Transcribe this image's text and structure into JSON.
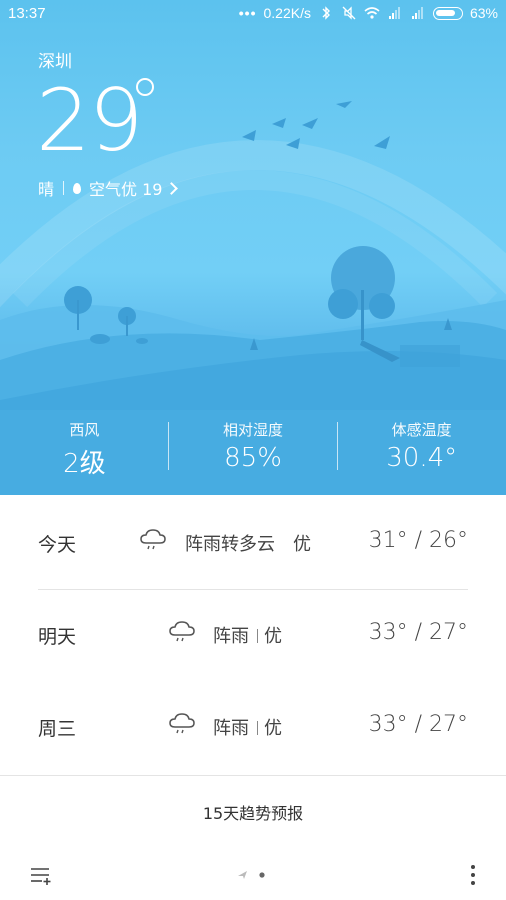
{
  "status_bar": {
    "time": "13:37",
    "network_speed": "0.22K/s",
    "battery_percent": "63%",
    "icons": [
      "dots-icon",
      "bluetooth-icon",
      "mute-icon",
      "wifi-icon",
      "signal-icon",
      "signal-icon",
      "battery-icon"
    ]
  },
  "current": {
    "city": "深圳",
    "temperature": "29",
    "condition": "晴",
    "air_quality": "空气优 19"
  },
  "stats": [
    {
      "label": "西风",
      "value": "2级"
    },
    {
      "label": "相对湿度",
      "value": "85%"
    },
    {
      "label": "体感温度",
      "value": "30.4°"
    }
  ],
  "forecast": [
    {
      "day": "今天",
      "condition": "阵雨转多云",
      "aqi": "优",
      "temp": "31° / 26°",
      "icon": "shower-cloud-icon"
    },
    {
      "day": "明天",
      "condition": "阵雨",
      "aqi": "优",
      "temp": "33° / 27°",
      "icon": "shower-cloud-icon"
    },
    {
      "day": "周三",
      "condition": "阵雨",
      "aqi": "优",
      "temp": "33° / 27°",
      "icon": "shower-cloud-icon"
    }
  ],
  "trend_link": "15天趋势预报",
  "colors": {
    "sky_top": "#5cc2ee",
    "hill_dark": "#3ea3da",
    "text_dark": "#333333"
  }
}
